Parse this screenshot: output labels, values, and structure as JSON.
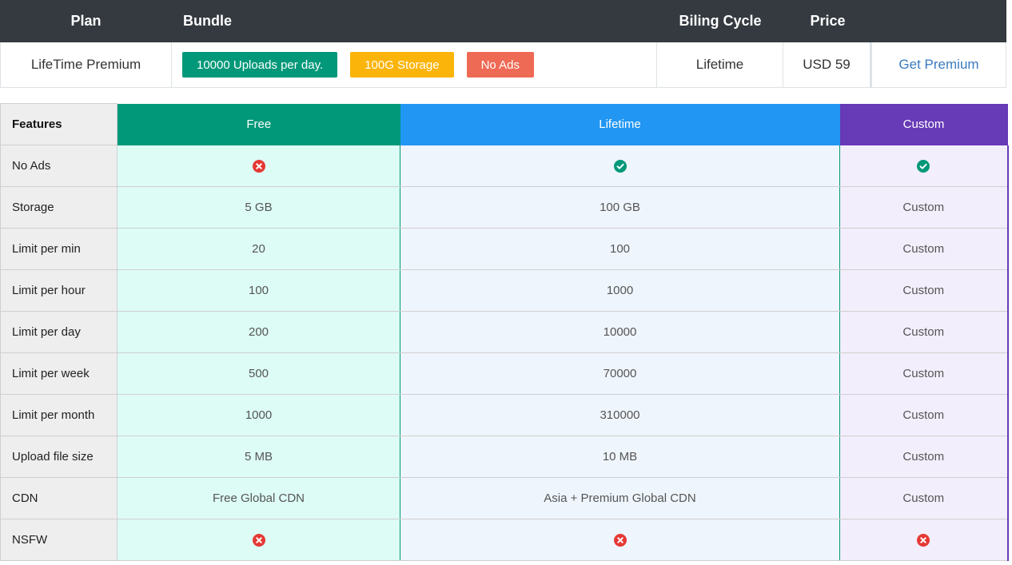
{
  "plan_table": {
    "headers": {
      "plan": "Plan",
      "bundle": "Bundle",
      "billing_cycle": "Biling Cycle",
      "price": "Price"
    },
    "row": {
      "plan": "LifeTime Premium",
      "bundle_badges": [
        "10000 Uploads per day.",
        "100G Storage",
        "No Ads"
      ],
      "billing_cycle": "Lifetime",
      "price": "USD 59",
      "action": "Get Premium"
    }
  },
  "features_table": {
    "headers": {
      "features": "Features",
      "free": "Free",
      "lifetime": "Lifetime",
      "custom": "Custom"
    },
    "rows": [
      {
        "feature": "No Ads",
        "free": "x",
        "lifetime": "check",
        "custom": "check"
      },
      {
        "feature": "Storage",
        "free": "5 GB",
        "lifetime": "100 GB",
        "custom": "Custom"
      },
      {
        "feature": "Limit per min",
        "free": "20",
        "lifetime": "100",
        "custom": "Custom"
      },
      {
        "feature": "Limit per hour",
        "free": "100",
        "lifetime": "1000",
        "custom": "Custom"
      },
      {
        "feature": "Limit per day",
        "free": "200",
        "lifetime": "10000",
        "custom": "Custom"
      },
      {
        "feature": "Limit per week",
        "free": "500",
        "lifetime": "70000",
        "custom": "Custom"
      },
      {
        "feature": "Limit per month",
        "free": "1000",
        "lifetime": "310000",
        "custom": "Custom"
      },
      {
        "feature": "Upload file size",
        "free": "5 MB",
        "lifetime": "10 MB",
        "custom": "Custom"
      },
      {
        "feature": "CDN",
        "free": "Free Global CDN",
        "lifetime": "Asia + Premium Global CDN",
        "custom": "Custom"
      },
      {
        "feature": "NSFW",
        "free": "x",
        "lifetime": "x",
        "custom": "x"
      }
    ]
  },
  "colors": {
    "free": "#009879",
    "lifetime": "#2196f3",
    "custom": "#673ab7",
    "check": "#009879",
    "cross": "#e53935"
  }
}
